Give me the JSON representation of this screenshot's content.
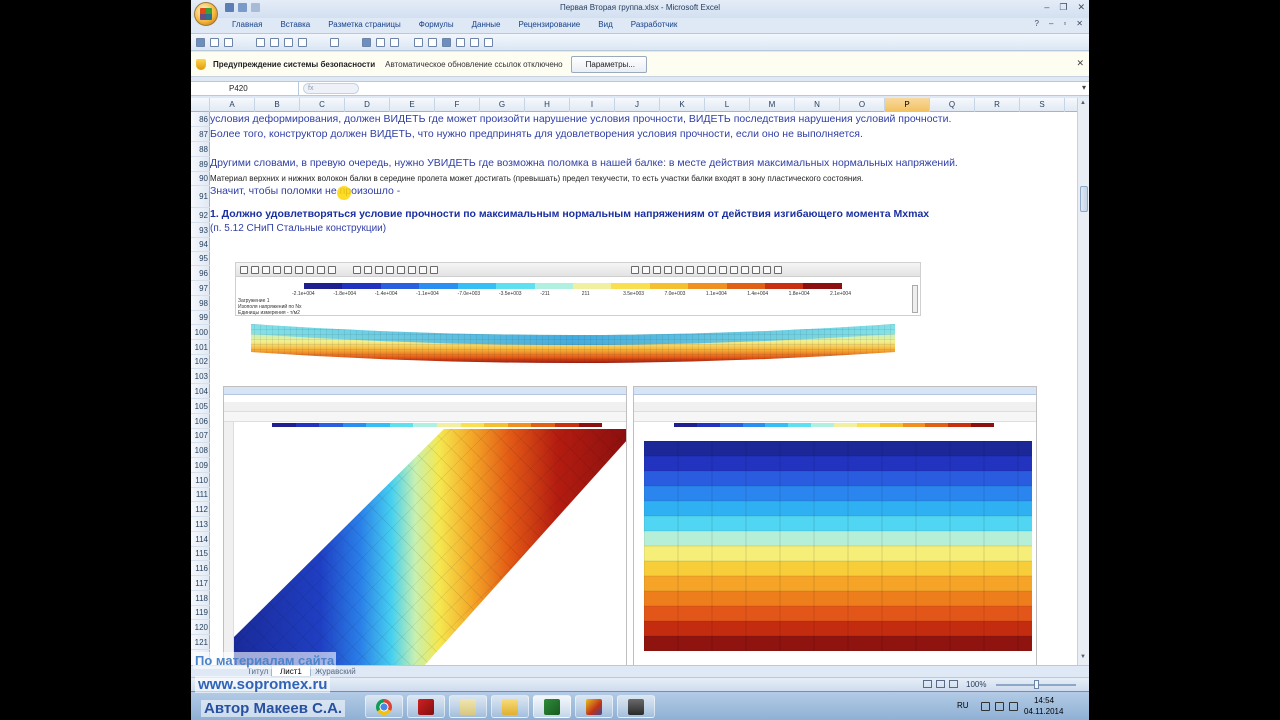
{
  "window": {
    "title": "Первая Вторая группа.xlsx - Microsoft Excel"
  },
  "ribbon": {
    "tabs": [
      "Главная",
      "Вставка",
      "Разметка страницы",
      "Формулы",
      "Данные",
      "Рецензирование",
      "Вид",
      "Разработчик"
    ]
  },
  "security_bar": {
    "title": "Предупреждение системы безопасности",
    "message": "Автоматическое обновление ссылок отключено",
    "button": "Параметры..."
  },
  "formula_bar": {
    "name_box": "P420",
    "fx": "fx"
  },
  "columns": [
    "A",
    "B",
    "C",
    "D",
    "E",
    "F",
    "G",
    "H",
    "I",
    "J",
    "K",
    "L",
    "M",
    "N",
    "O",
    "P",
    "Q",
    "R",
    "S"
  ],
  "selected_column": "P",
  "rows": [
    "86",
    "87",
    "88",
    "89",
    "90",
    "91",
    "92",
    "93",
    "94",
    "95",
    "96",
    "97",
    "98",
    "99",
    "100",
    "101",
    "102",
    "103",
    "104",
    "105",
    "106",
    "107",
    "108",
    "109",
    "110",
    "111",
    "112",
    "113",
    "114",
    "115",
    "116",
    "117",
    "118",
    "119",
    "120",
    "121"
  ],
  "text_lines": {
    "r86": "условия деформирования, должен ВИДЕТЬ где может произойти нарушение условия прочности, ВИДЕТЬ последствия нарушения условий прочности.",
    "r87": "Более того, конструктор должен ВИДЕТЬ, что нужно предпринять для удовлетворения условия прочности, если оно не выполняется.",
    "r89": "Другими словами, в превую очередь, нужно УВИДЕТЬ где возможна поломка в нашей балке: в месте действия максимальных нормальных напряжений.",
    "r90": "Материал верхних и нижних волокон балки в середине пролета может достигать (превышать) предел текучести, то есть участки балки входят в зону пластического состояния.",
    "r91": "Значит, чтобы поломки не произошло -",
    "r92": "1. Должно удовлетворяться условие прочности по максимальным нормальным напряжениям от действия изгибающего момента Mxmax",
    "r93": "(п. 5.12 СНиП Стальные конструкции)"
  },
  "embedded_chart": {
    "scale_ticks": [
      "-2.1e+004",
      "-1.8e+004",
      "-1.4e+004",
      "-1.1e+004",
      "-7.0e+003",
      "-3.5e+003",
      "-211",
      "211",
      "3.5e+003",
      "7.0e+003",
      "1.1e+004",
      "1.4e+004",
      "1.8e+004",
      "2.1e+004"
    ],
    "legend": [
      "Загружение 1",
      "Изополя напряжений по Nx",
      "Единицы измерения - т/м2"
    ],
    "scale_colors": [
      "#1f1f8f",
      "#2233c0",
      "#2a5fe0",
      "#2a8ff0",
      "#35bff5",
      "#5fe0f0",
      "#b0f0e0",
      "#f0f0a0",
      "#f8e050",
      "#f5c030",
      "#f09020",
      "#e06015",
      "#c83010",
      "#8c1010"
    ]
  },
  "sheet_tabs": [
    "Титул",
    "Лист1",
    "Журавский"
  ],
  "active_sheet": "Лист1",
  "status": {
    "zoom": "100%"
  },
  "taskbar": {
    "lang": "RU",
    "time": "14:54",
    "date": "04.11.2014"
  },
  "watermark": {
    "line1": "По материалам сайта",
    "line2": "www.sopromex.ru",
    "line3": "Автор Макеев С.А."
  }
}
